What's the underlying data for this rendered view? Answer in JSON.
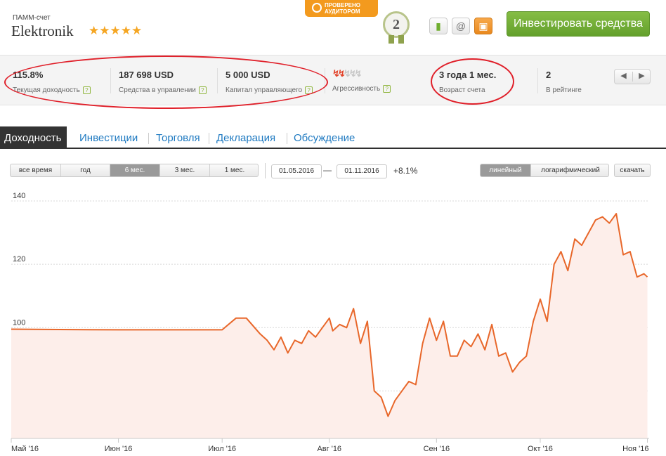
{
  "header": {
    "account_type": "ПАММ-счет",
    "account_name": "Elektronik",
    "rating_stars": "★★★★★",
    "audit_badge_line1": "ПРОВЕРЕНО",
    "audit_badge_line2": "АУДИТОРОМ",
    "medal_number": "2",
    "invest_button": "Инвестировать средства",
    "icons": [
      "bookmark-icon",
      "email-icon",
      "briefcase-icon"
    ]
  },
  "stats": [
    {
      "value": "115.8%",
      "label": "Текущая доходность"
    },
    {
      "value": "187 698 USD",
      "label": "Средства в управлении"
    },
    {
      "value": "5 000 USD",
      "label": "Капитал управляющего"
    },
    {
      "value": "",
      "label": "Агрессивность",
      "aggressiveness_level": 2,
      "aggressiveness_max": 5
    },
    {
      "value": "3 года 1 мес.",
      "label": "Возраст счета"
    },
    {
      "value": "2",
      "label": "В рейтинге"
    }
  ],
  "tabs": [
    "Доходность",
    "Инвестиции",
    "Торговля",
    "Декларация",
    "Обсуждение"
  ],
  "active_tab": "Доходность",
  "controls": {
    "periods": [
      "все время",
      "год",
      "6 мес.",
      "3 мес.",
      "1 мес."
    ],
    "selected_period": "6 мес.",
    "date_from": "01.05.2016",
    "date_dash": "—",
    "date_to": "01.11.2016",
    "change": "+8.1%",
    "scales": [
      "линейный",
      "логарифмический"
    ],
    "selected_scale": "линейный",
    "download": "скачать"
  },
  "colors": {
    "line": "#e8672a",
    "fill": "#fdeeea",
    "invest_button": "#72ae37",
    "highlight_oval": "#e0202a"
  },
  "chart_data": {
    "type": "area",
    "y_ticks": [
      80,
      100,
      120,
      140
    ],
    "ylim": [
      65,
      144
    ],
    "x_ticks": [
      "Май '16",
      "Июн '16",
      "Июл '16",
      "Авг '16",
      "Сен '16",
      "Окт '16",
      "Ноя '16"
    ],
    "grid": true,
    "series": [
      {
        "x": [
          "2016-05-01",
          "2016-05-15",
          "2016-06-01",
          "2016-06-15",
          "2016-07-01",
          "2016-07-05",
          "2016-07-08",
          "2016-07-12",
          "2016-07-14",
          "2016-07-16",
          "2016-07-18",
          "2016-07-20",
          "2016-07-22",
          "2016-07-24",
          "2016-07-26",
          "2016-07-28",
          "2016-07-30",
          "2016-08-01",
          "2016-08-02",
          "2016-08-04",
          "2016-08-06",
          "2016-08-08",
          "2016-08-10",
          "2016-08-12",
          "2016-08-14",
          "2016-08-16",
          "2016-08-18",
          "2016-08-20",
          "2016-08-22",
          "2016-08-24",
          "2016-08-26",
          "2016-08-28",
          "2016-08-30",
          "2016-09-01",
          "2016-09-03",
          "2016-09-05",
          "2016-09-07",
          "2016-09-09",
          "2016-09-11",
          "2016-09-13",
          "2016-09-15",
          "2016-09-17",
          "2016-09-19",
          "2016-09-21",
          "2016-09-23",
          "2016-09-25",
          "2016-09-27",
          "2016-09-29",
          "2016-10-01",
          "2016-10-03",
          "2016-10-05",
          "2016-10-07",
          "2016-10-09",
          "2016-10-11",
          "2016-10-13",
          "2016-10-15",
          "2016-10-17",
          "2016-10-19",
          "2016-10-21",
          "2016-10-23",
          "2016-10-25",
          "2016-10-27",
          "2016-10-29",
          "2016-10-31",
          "2016-11-01"
        ],
        "values": [
          99.5,
          99.4,
          99.3,
          99.3,
          99.3,
          103,
          103,
          98,
          96,
          93,
          97,
          92,
          96,
          95,
          99,
          97,
          100,
          103,
          99,
          101,
          100,
          106,
          95,
          102,
          80,
          78,
          72,
          77,
          80,
          83,
          82,
          95,
          103,
          96,
          102,
          91,
          91,
          96,
          94,
          98,
          93,
          101,
          91,
          92,
          86,
          89,
          91,
          102,
          109,
          102,
          120,
          124,
          118,
          128,
          126,
          130,
          134,
          135,
          133,
          136,
          123,
          124,
          116,
          117,
          116
        ]
      }
    ]
  }
}
